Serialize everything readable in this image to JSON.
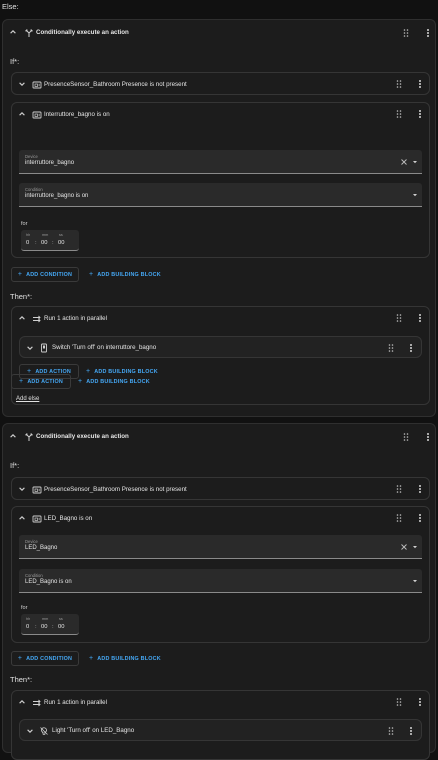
{
  "else_label": "Else:",
  "block1": {
    "title": "Conditionally execute an action",
    "if_label": "If*:",
    "cond1": "PresenceSensor_Bathroom Presence is not present",
    "cond2": {
      "title": "Interruttore_bagno is on",
      "device_label": "Device",
      "device_value": "interruttore_bagno",
      "condition_label": "Condition",
      "condition_value": "interruttore_bagno is on",
      "for_label": "for",
      "hh_label": "hh",
      "mm_label": "mm",
      "ss_label": "ss",
      "hh": "0",
      "mm": "00",
      "ss": "00"
    },
    "add_condition": "ADD CONDITION",
    "add_building_block": "ADD BUILDING BLOCK",
    "then_label": "Then*:",
    "parallel_title": "Run 1 action in parallel",
    "action_title": "Switch 'Turn off' on interruttore_bagno",
    "add_action": "ADD ACTION",
    "add_building_block_inner": "ADD BUILDING BLOCK",
    "add_action_outer": "ADD ACTION",
    "add_building_block_outer": "ADD BUILDING BLOCK",
    "add_else": "Add else"
  },
  "block2": {
    "title": "Conditionally execute an action",
    "if_label": "If*:",
    "cond1": "PresenceSensor_Bathroom Presence is not present",
    "cond2": {
      "title": "LED_Bagno is on",
      "device_label": "Device",
      "device_value": "LED_Bagno",
      "condition_label": "Condition",
      "condition_value": "LED_Bagno is on",
      "for_label": "for",
      "hh_label": "hh",
      "mm_label": "mm",
      "ss_label": "ss",
      "hh": "0",
      "mm": "00",
      "ss": "00"
    },
    "add_condition": "ADD CONDITION",
    "add_building_block": "ADD BUILDING BLOCK",
    "then_label": "Then*:",
    "parallel_title": "Run 1 action in parallel",
    "action_title": "Light 'Turn off' on LED_Bagno"
  },
  "colors": {
    "accent": "#45a8f5",
    "background": "#111111",
    "card": "#1c1c1c"
  }
}
